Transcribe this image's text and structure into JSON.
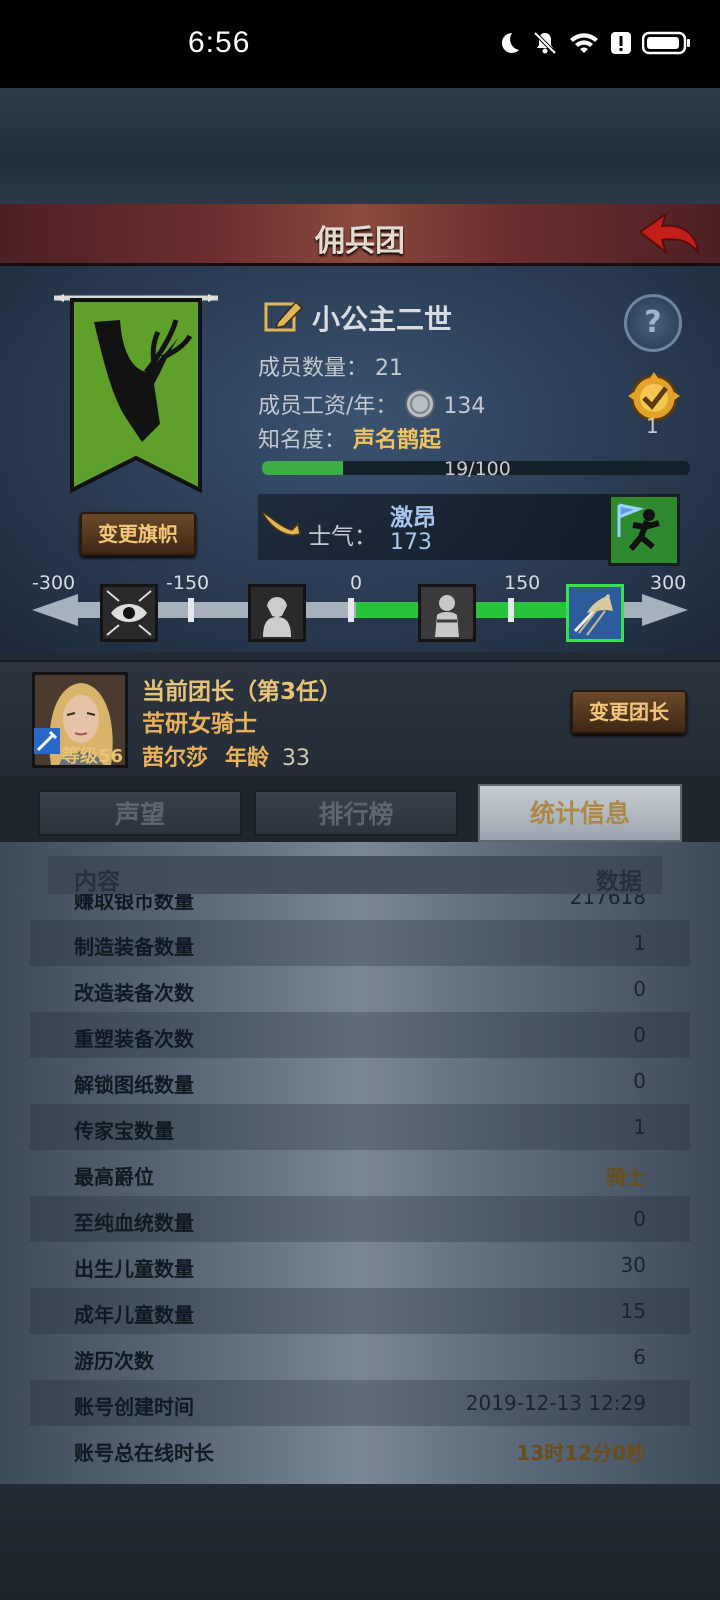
{
  "status_bar": {
    "time": "6:56"
  },
  "header": {
    "title": "佣兵团"
  },
  "guild": {
    "name": "小公主二世",
    "members_label": "成员数量：",
    "members_value": "21",
    "salary_label": "成员工资/年：",
    "salary_value": "134",
    "fame_label": "知名度：",
    "fame_value": "声名鹊起",
    "fame_progress_text": "19/100",
    "fame_progress": 0.19,
    "medal_count": "1",
    "change_flag_label": "变更旗帜",
    "flag_color": "#5ea02a"
  },
  "morale": {
    "label": "士气：",
    "state": "激昂",
    "value": "173",
    "scale_labels": [
      "-300",
      "-150",
      "0",
      "150",
      "300"
    ]
  },
  "leader": {
    "title": "当前团长（第3任）",
    "class": "苦研女骑士",
    "name": "茜尔莎",
    "age_label": "年龄",
    "age": "33",
    "level_label": "等级",
    "level": "56",
    "change_leader_label": "变更团长"
  },
  "tabs": [
    {
      "label": "声望"
    },
    {
      "label": "排行榜"
    },
    {
      "label": "统计信息"
    }
  ],
  "table": {
    "headers": {
      "content": "内容",
      "data": "数据"
    },
    "rows": [
      {
        "key": "赚取银币数量",
        "value": "217618"
      },
      {
        "key": "制造装备数量",
        "value": "1"
      },
      {
        "key": "改造装备次数",
        "value": "0"
      },
      {
        "key": "重塑装备次数",
        "value": "0"
      },
      {
        "key": "解锁图纸数量",
        "value": "0"
      },
      {
        "key": "传家宝数量",
        "value": "1"
      },
      {
        "key": "最高爵位",
        "value": "骑士"
      },
      {
        "key": "至纯血统数量",
        "value": "0"
      },
      {
        "key": "出生儿童数量",
        "value": "30"
      },
      {
        "key": "成年儿童数量",
        "value": "15"
      },
      {
        "key": "游历次数",
        "value": "6"
      },
      {
        "key": "账号创建时间",
        "value": "2019-12-13 12:29"
      },
      {
        "key": "账号总在线时长",
        "value": "13时12分0秒"
      }
    ]
  },
  "icons": {
    "status": [
      "moon-icon",
      "bell-off-icon",
      "wifi-icon",
      "alert-icon",
      "battery-icon"
    ],
    "mood": [
      "sad-eye-icon",
      "despair-icon",
      "neutral-icon",
      "excited-flag-icon"
    ]
  }
}
